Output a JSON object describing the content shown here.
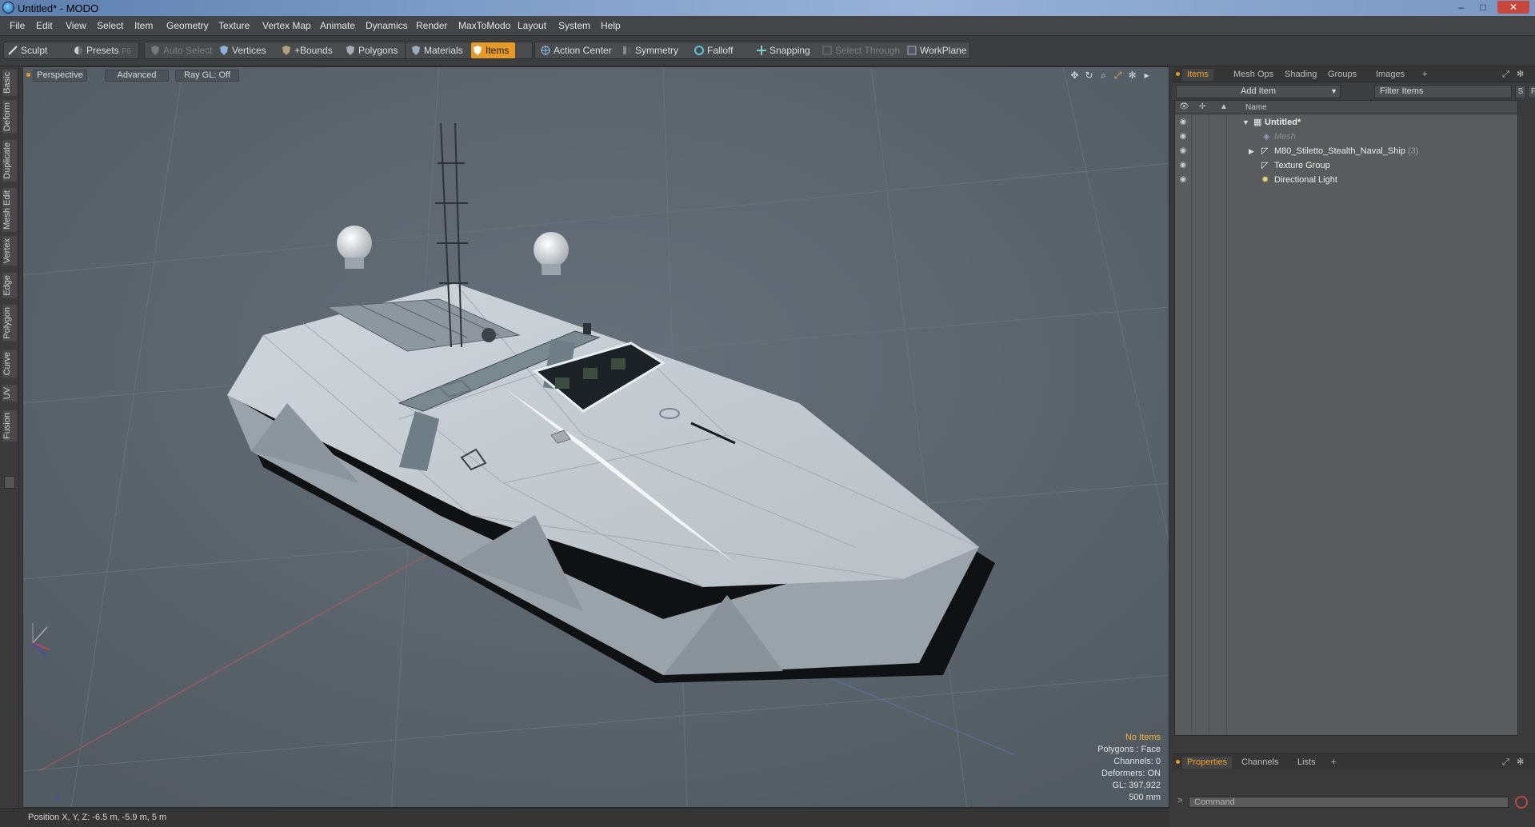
{
  "window": {
    "title": "Untitled* - MODO",
    "minimize_glyph": "–",
    "maximize_glyph": "□",
    "close_glyph": "✕"
  },
  "menubar": {
    "items": [
      "File",
      "Edit",
      "View",
      "Select",
      "Item",
      "Geometry",
      "Texture",
      "Vertex Map",
      "Animate",
      "Dynamics",
      "Render",
      "MaxToModo",
      "Layout",
      "System",
      "Help"
    ]
  },
  "toolbar": {
    "sculpt": "Sculpt",
    "presets": "Presets",
    "presets_hint": "F6",
    "auto_select": "Auto Select",
    "vertices": "Vertices",
    "bounds": "+Bounds",
    "polygons": "Polygons",
    "materials": "Materials",
    "items": "Items",
    "action_center": "Action Center",
    "symmetry": "Symmetry",
    "falloff": "Falloff",
    "snapping": "Snapping",
    "select_through": "Select Through",
    "workplane": "WorkPlane"
  },
  "left_tabs": [
    "Basic",
    "Deform",
    "Duplicate",
    "Mesh Edit",
    "Vertex",
    "Edge",
    "Polygon",
    "Curve",
    "UV",
    "Fusion"
  ],
  "viewport": {
    "view_mode": "Perspective",
    "shading": "Advanced",
    "ray_gl": "Ray GL: Off",
    "info": {
      "selection": "No Items",
      "polygons": "Polygons : Face",
      "channels": "Channels: 0",
      "deformers": "Deformers: ON",
      "gl": "GL: 397,922",
      "grid": "500 mm"
    },
    "axis": {
      "x": "X",
      "z": "Z"
    }
  },
  "right_panel": {
    "tabs": [
      "Items",
      "Mesh Ops",
      "Shading",
      "Groups",
      "Images"
    ],
    "active_tab": "Items",
    "add_item": "Add Item",
    "filter_placeholder": "Filter Items",
    "filter_s": "S",
    "filter_f": "F",
    "column_name": "Name",
    "tree": [
      {
        "label": "Untitled*",
        "count": ""
      },
      {
        "label": "Mesh",
        "count": ""
      },
      {
        "label": "M80_Stiletto_Stealth_Naval_Ship",
        "count": "(3)"
      },
      {
        "label": "Texture Group",
        "count": ""
      },
      {
        "label": "Directional Light",
        "count": ""
      }
    ],
    "bottom_tabs": [
      "Properties",
      "Channels",
      "Lists"
    ],
    "command_placeholder": "Command"
  },
  "statusbar": {
    "position": "Position X, Y, Z:  -6.5 m, -5.9 m, 5 m"
  },
  "colors": {
    "accent": "#e59a28",
    "viewport_bg": "#5d666d",
    "hull": "#c4cbd1"
  }
}
